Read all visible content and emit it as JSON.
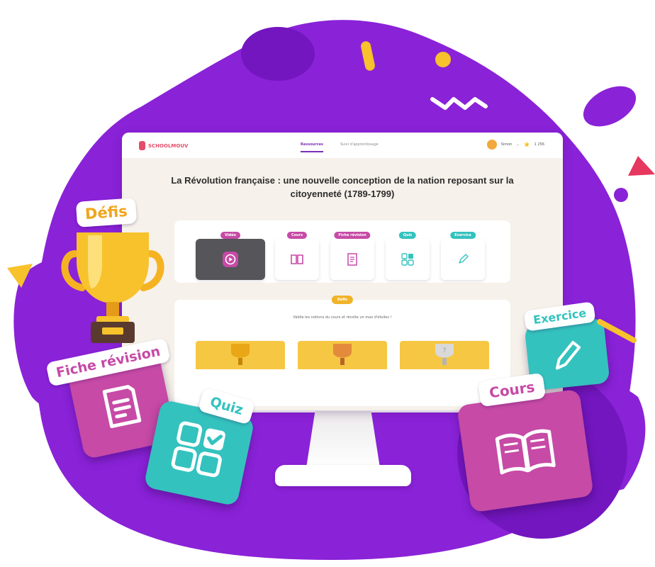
{
  "brand": {
    "logo_text": "SCHOOLMOUV",
    "colors": {
      "purple": "#8a22d8",
      "pink": "#c64aa6",
      "teal": "#34c2be",
      "yellow": "#f7c22c",
      "red": "#e6375f"
    }
  },
  "nav": {
    "tabs": [
      {
        "label": "Ressources",
        "active": true
      },
      {
        "label": "Suivi d'apprentissage",
        "active": false
      }
    ],
    "user_name": "Simon",
    "stars": "1 256"
  },
  "page": {
    "title": "La Révolution française : une nouvelle conception de la nation reposant sur la citoyenneté (1789-1799)"
  },
  "modules": [
    {
      "label": "Vidéo",
      "icon": "play-icon",
      "color": "#c64aa6"
    },
    {
      "label": "Cours",
      "icon": "book-icon",
      "color": "#c64aa6"
    },
    {
      "label": "Fiche révision",
      "icon": "document-icon",
      "color": "#c64aa6"
    },
    {
      "label": "Quiz",
      "icon": "quiz-grid-icon",
      "color": "#34c2be"
    },
    {
      "label": "Exercice",
      "icon": "pencil-icon",
      "color": "#34c2be"
    }
  ],
  "defis": {
    "badge": "Défis",
    "description": "Valide les notions du cours et récolte un max d'étoiles !"
  },
  "floating": {
    "defis": "Défis",
    "fiche_revision": "Fiche révision",
    "quiz": "Quiz",
    "exercice": "Exercice",
    "cours": "Cours"
  }
}
